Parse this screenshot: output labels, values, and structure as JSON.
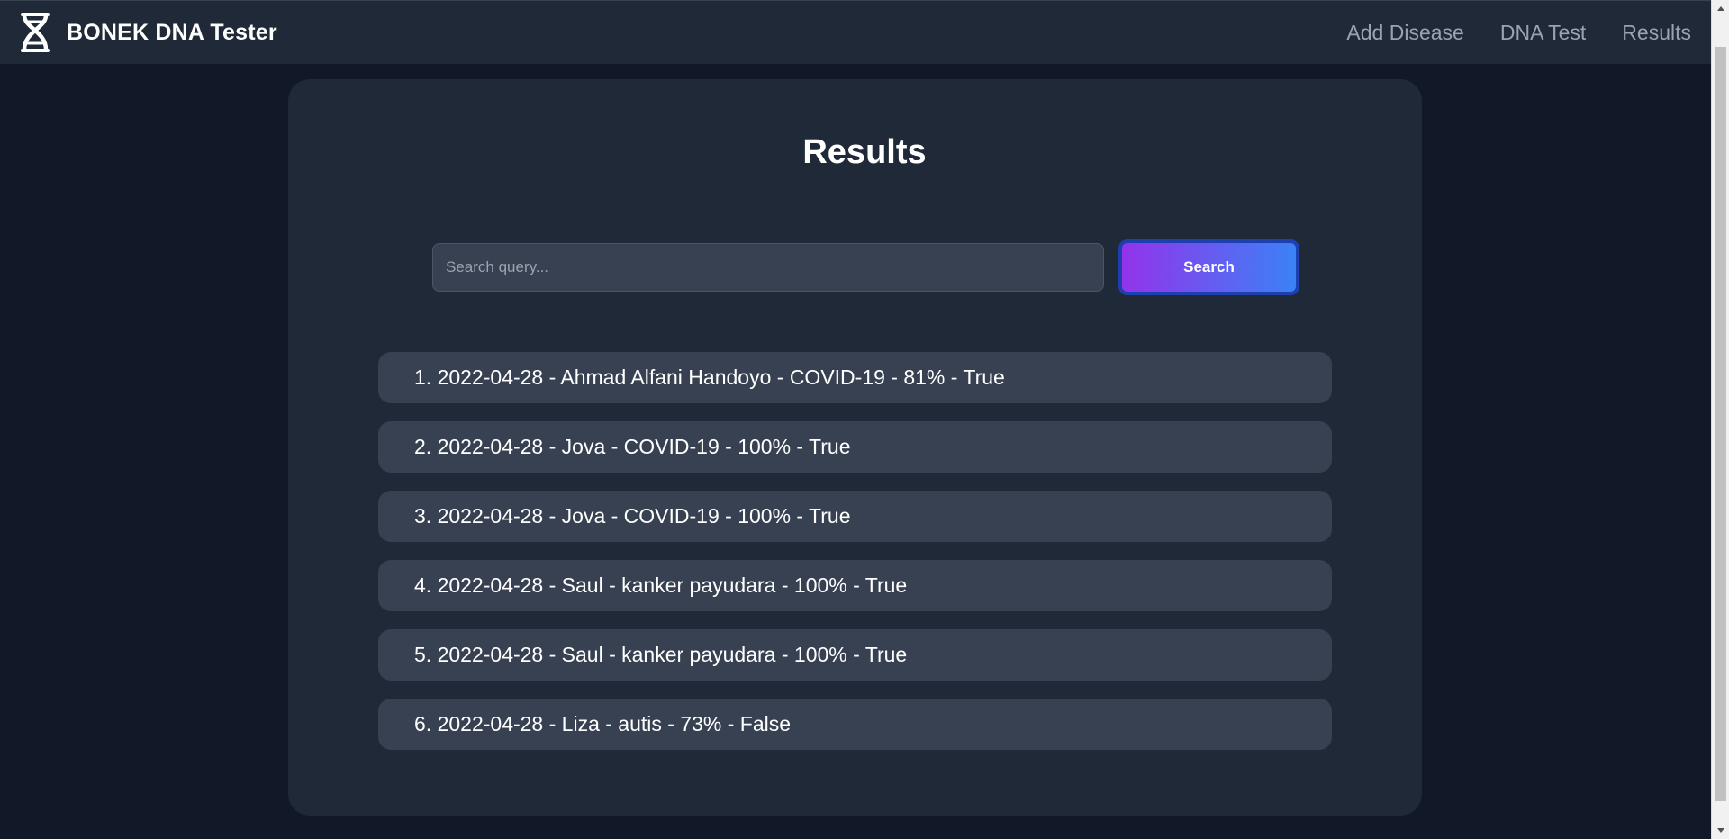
{
  "navbar": {
    "brand_title": "BONEK DNA Tester",
    "links": [
      {
        "label": "Add Disease"
      },
      {
        "label": "DNA Test"
      },
      {
        "label": "Results"
      }
    ]
  },
  "main": {
    "title": "Results",
    "search": {
      "placeholder": "Search query...",
      "value": "",
      "button_label": "Search"
    },
    "results": [
      {
        "text": "1. 2022-04-28 - Ahmad Alfani Handoyo - COVID-19 - 81% - True"
      },
      {
        "text": "2. 2022-04-28 - Jova - COVID-19 - 100% - True"
      },
      {
        "text": "3. 2022-04-28 - Jova - COVID-19 - 100% - True"
      },
      {
        "text": "4. 2022-04-28 - Saul - kanker payudara - 100% - True"
      },
      {
        "text": "5. 2022-04-28 - Saul - kanker payudara - 100% - True"
      },
      {
        "text": "6. 2022-04-28 - Liza - autis - 73% - False"
      }
    ]
  },
  "colors": {
    "page_background": "#111827",
    "surface": "#1f2937",
    "item_background": "#374151",
    "button_gradient_start": "#9333ea",
    "button_gradient_end": "#3b82f6",
    "button_border": "#1e40af",
    "nav_link": "#9ca3af"
  },
  "icons": {
    "brand": "dna-icon"
  }
}
